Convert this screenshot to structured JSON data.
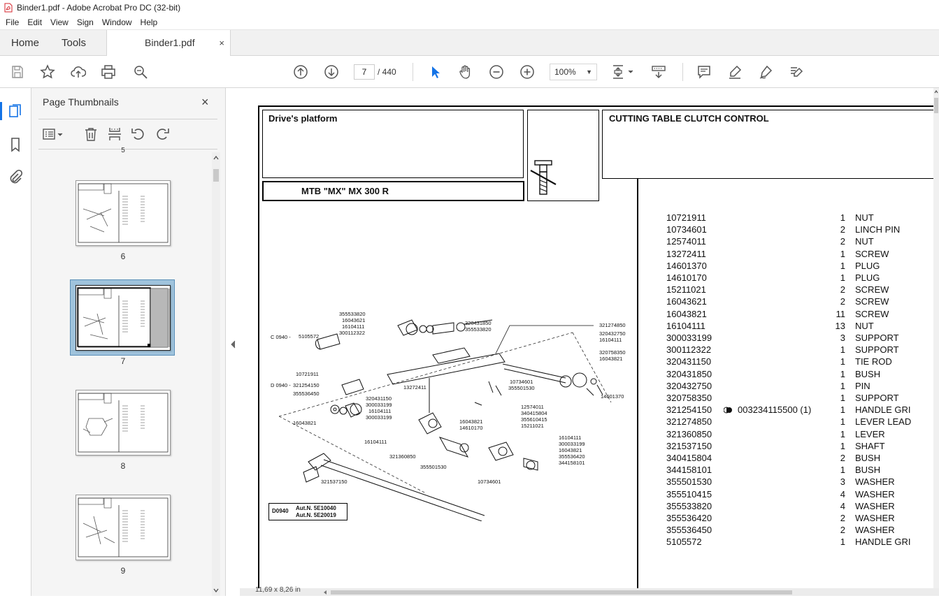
{
  "window": {
    "title": "Binder1.pdf - Adobe Acrobat Pro DC (32-bit)"
  },
  "menu": [
    "File",
    "Edit",
    "View",
    "Sign",
    "Window",
    "Help"
  ],
  "tabs": {
    "home": "Home",
    "tools": "Tools",
    "document": "Binder1.pdf",
    "close": "×"
  },
  "nav": {
    "current_page": "7",
    "total_pages": "/ 440",
    "zoom": "100%"
  },
  "panel": {
    "title": "Page Thumbnails",
    "close": "×",
    "thumbnails": [
      {
        "label": "6",
        "selected": false
      },
      {
        "label": "7",
        "selected": true
      },
      {
        "label": "8",
        "selected": false
      },
      {
        "label": "9",
        "selected": false
      }
    ],
    "top_partial_label": "5"
  },
  "status": {
    "page_size": "11,69 x 8,26 in"
  },
  "colors": {
    "accent": "#1473e6",
    "selected_thumb_bg": "#9fc3dc",
    "toolbar_icon": "#555555"
  },
  "document": {
    "header_left": "Drive's platform",
    "header_right": "CUTTING TABLE CLUTCH CONTROL",
    "model": "MTB \"MX\"   MX 300 R",
    "drawing_ref_code": "D0940",
    "drawing_ref_auth1": "Aut.N. 5E10040",
    "drawing_ref_auth2": "Aut.N. 5E20019",
    "parts": [
      {
        "code": "10721911",
        "qty": "1",
        "desc": "NUT"
      },
      {
        "code": "10734601",
        "qty": "2",
        "desc": "LINCH PIN"
      },
      {
        "code": "12574011",
        "qty": "2",
        "desc": "NUT"
      },
      {
        "code": "13272411",
        "qty": "1",
        "desc": "SCREW"
      },
      {
        "code": "14601370",
        "qty": "1",
        "desc": "PLUG"
      },
      {
        "code": "14610170",
        "qty": "1",
        "desc": "PLUG"
      },
      {
        "code": "15211021",
        "qty": "2",
        "desc": "SCREW"
      },
      {
        "code": "16043621",
        "qty": "2",
        "desc": "SCREW"
      },
      {
        "code": "16043821",
        "qty": "11",
        "desc": "SCREW"
      },
      {
        "code": "16104111",
        "qty": "13",
        "desc": "NUT"
      },
      {
        "code": "300033199",
        "qty": "3",
        "desc": "SUPPORT"
      },
      {
        "code": "300112322",
        "qty": "1",
        "desc": "SUPPORT"
      },
      {
        "code": "320431150",
        "qty": "1",
        "desc": "TIE ROD"
      },
      {
        "code": "320431850",
        "qty": "1",
        "desc": "BUSH"
      },
      {
        "code": "320432750",
        "qty": "1",
        "desc": "PIN"
      },
      {
        "code": "320758350",
        "qty": "1",
        "desc": "SUPPORT"
      },
      {
        "code": "321254150",
        "qty": "1",
        "desc": "HANDLE GRI",
        "alt": "003234115500  (1)"
      },
      {
        "code": "321274850",
        "qty": "1",
        "desc": "LEVER LEAD"
      },
      {
        "code": "321360850",
        "qty": "1",
        "desc": "LEVER"
      },
      {
        "code": "321537150",
        "qty": "1",
        "desc": "SHAFT"
      },
      {
        "code": "340415804",
        "qty": "2",
        "desc": "BUSH"
      },
      {
        "code": "344158101",
        "qty": "1",
        "desc": "BUSH"
      },
      {
        "code": "355501530",
        "qty": "3",
        "desc": "WASHER"
      },
      {
        "code": "355510415",
        "qty": "4",
        "desc": "WASHER"
      },
      {
        "code": "355533820",
        "qty": "4",
        "desc": "WASHER"
      },
      {
        "code": "355536420",
        "qty": "2",
        "desc": "WASHER"
      },
      {
        "code": "355536450",
        "qty": "2",
        "desc": "WASHER"
      },
      {
        "code": "5105572",
        "qty": "1",
        "desc": "HANDLE GRI"
      }
    ],
    "diagram_labels": [
      "355533820",
      "16043621",
      "16104111",
      "300112322",
      "320431850",
      "355533820",
      "321274850",
      "320432750",
      "16104111",
      "320758350",
      "16043821",
      "C 0940 -",
      "5105572",
      "10721911",
      "D 0940 -",
      "321254150",
      "355536450",
      "13272411",
      "10734601",
      "355501530",
      "14601370",
      "320431150",
      "300033199",
      "16104111",
      "300033199",
      "12574011",
      "340415804",
      "355610415",
      "15211021",
      "16043821",
      "14610170",
      "16043821",
      "16104111",
      "321360850",
      "355501530",
      "16104111",
      "300033199",
      "16043821",
      "355536420",
      "344158101",
      "10734601",
      "321537150"
    ]
  }
}
